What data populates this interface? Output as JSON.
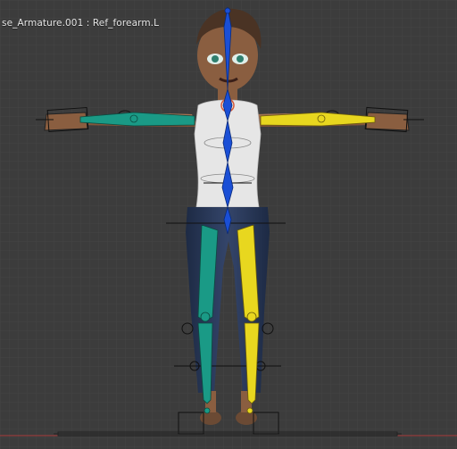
{
  "viewport": {
    "header_text": "se_Armature.001 : Ref_forearm.L",
    "colors": {
      "background": "#3c3c3c",
      "grid": "#474747",
      "bone_left": "#1a9a86",
      "bone_right": "#e8d71f",
      "bone_center": "#1a4fd6",
      "floor_line": "#a83a3a"
    }
  }
}
